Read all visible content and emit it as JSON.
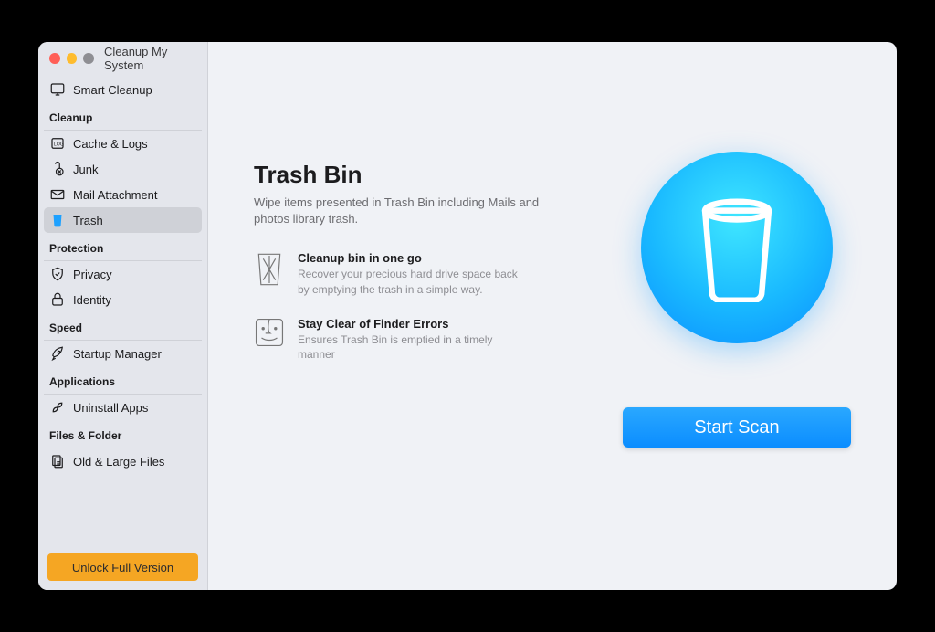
{
  "window": {
    "title": "Cleanup My System"
  },
  "sidebar": {
    "top": {
      "label": "Smart Cleanup"
    },
    "sections": [
      {
        "title": "Cleanup",
        "items": [
          {
            "id": "cache",
            "label": "Cache & Logs",
            "icon": "log-icon"
          },
          {
            "id": "junk",
            "label": "Junk",
            "icon": "junk-icon"
          },
          {
            "id": "mail",
            "label": "Mail Attachment",
            "icon": "mail-icon"
          },
          {
            "id": "trash",
            "label": "Trash",
            "icon": "trash-icon",
            "selected": true
          }
        ]
      },
      {
        "title": "Protection",
        "items": [
          {
            "id": "privacy",
            "label": "Privacy",
            "icon": "shield-icon"
          },
          {
            "id": "identity",
            "label": "Identity",
            "icon": "lock-icon"
          }
        ]
      },
      {
        "title": "Speed",
        "items": [
          {
            "id": "startup",
            "label": "Startup Manager",
            "icon": "rocket-icon"
          }
        ]
      },
      {
        "title": "Applications",
        "items": [
          {
            "id": "uninstall",
            "label": "Uninstall Apps",
            "icon": "app-icon"
          }
        ]
      },
      {
        "title": "Files & Folder",
        "items": [
          {
            "id": "oldlarge",
            "label": "Old & Large Files",
            "icon": "files-icon"
          }
        ]
      }
    ],
    "unlock_label": "Unlock Full Version"
  },
  "main": {
    "title": "Trash Bin",
    "subtitle": "Wipe items presented in Trash Bin including Mails and photos library trash.",
    "features": [
      {
        "title": "Cleanup bin in one go",
        "desc": "Recover your precious hard drive space back by emptying the trash in a simple way."
      },
      {
        "title": "Stay Clear of Finder Errors",
        "desc": "Ensures Trash Bin is emptied in a timely manner"
      }
    ],
    "start_scan_label": "Start Scan"
  }
}
